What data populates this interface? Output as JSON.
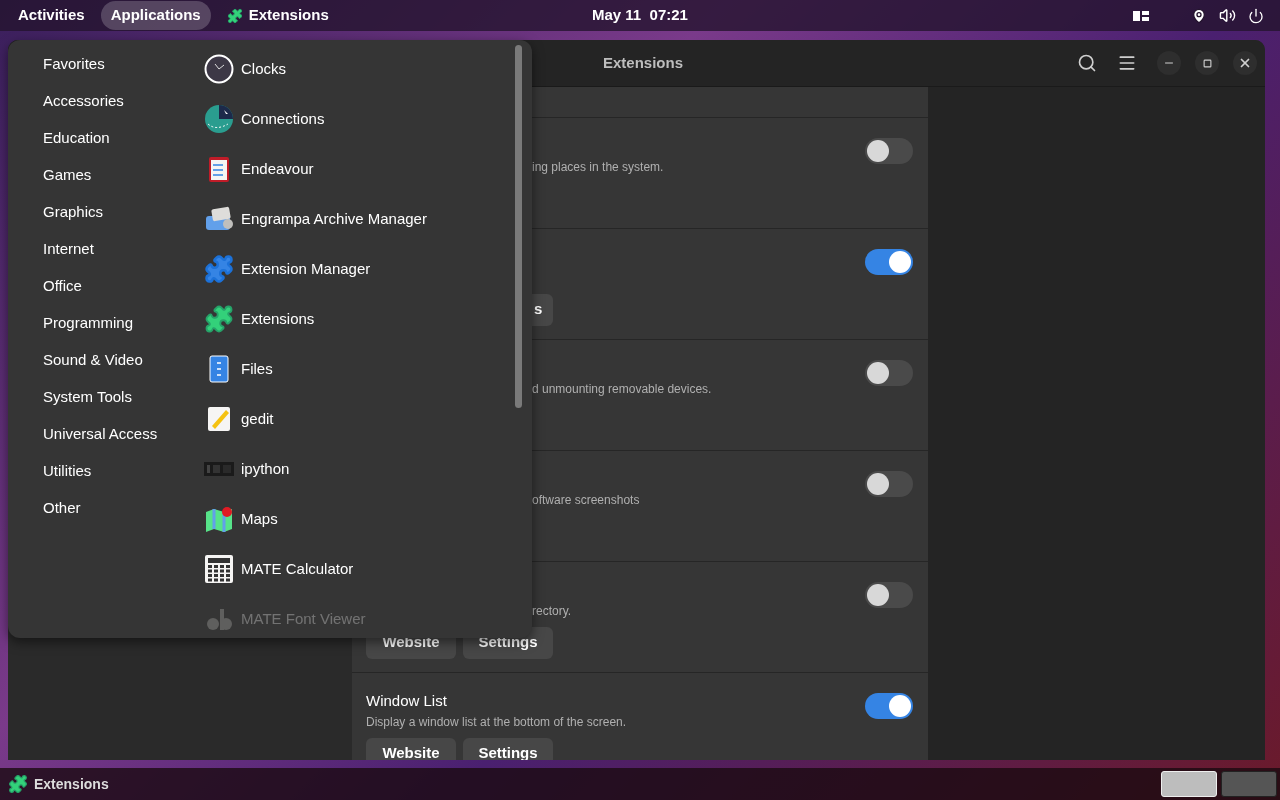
{
  "top_bar": {
    "activities": "Activities",
    "menus": [
      {
        "label": "Applications",
        "selected": true,
        "kind": "text"
      },
      {
        "label": "Extensions",
        "selected": false,
        "kind": "app"
      }
    ],
    "clock": "May 11  07:21"
  },
  "window": {
    "title": "Extensions",
    "extensions": [
      {
        "description": "ing places in the system.",
        "covered": true,
        "on": false
      },
      {
        "on": true,
        "buttons": [
          "s"
        ],
        "buttons_covered": true
      },
      {
        "description": "d unmounting removable devices.",
        "covered": true,
        "on": false
      },
      {
        "description": "oftware screenshots",
        "covered": true,
        "on": false
      },
      {
        "description": "rectory.",
        "covered": true,
        "on": false,
        "buttons": [
          "Website",
          "Settings"
        ],
        "buttons_covered": false
      },
      {
        "title": "Window List",
        "description": "Display a window list at the bottom of the screen.",
        "covered": false,
        "on": true,
        "buttons": [
          "Website",
          "Settings"
        ],
        "buttons_covered": false
      }
    ]
  },
  "app_menu": {
    "categories": [
      "Favorites",
      "Accessories",
      "Education",
      "Games",
      "Graphics",
      "Internet",
      "Office",
      "Programming",
      "Sound & Video",
      "System Tools",
      "Universal Access",
      "Utilities",
      "Other"
    ],
    "apps": [
      {
        "name": "Clocks",
        "faded": false
      },
      {
        "name": "Connections",
        "faded": false
      },
      {
        "name": "Endeavour",
        "faded": false
      },
      {
        "name": "Engrampa Archive Manager",
        "faded": false
      },
      {
        "name": "Extension Manager",
        "faded": false
      },
      {
        "name": "Extensions",
        "faded": false
      },
      {
        "name": "Files",
        "faded": false
      },
      {
        "name": "gedit",
        "faded": false
      },
      {
        "name": "ipython",
        "faded": false
      },
      {
        "name": "Maps",
        "faded": false
      },
      {
        "name": "MATE Calculator",
        "faded": false
      },
      {
        "name": "MATE Font Viewer",
        "faded": true
      }
    ]
  },
  "taskbar": {
    "task": "Extensions",
    "workspaces": [
      {
        "selected": true
      },
      {
        "selected": false
      }
    ]
  }
}
